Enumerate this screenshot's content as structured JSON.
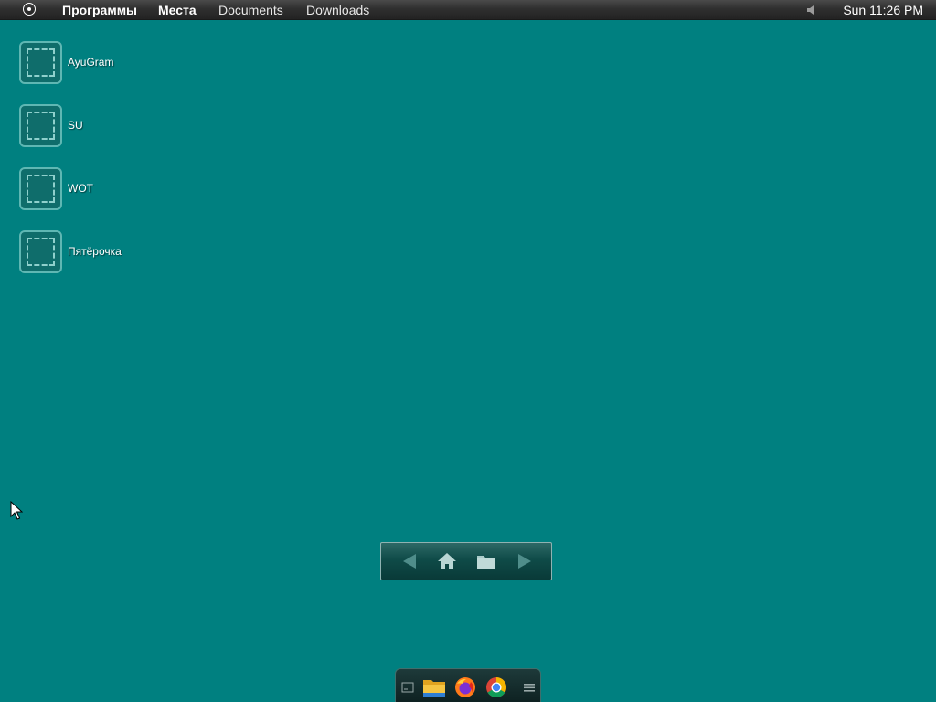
{
  "top_panel": {
    "menu_icon": "circle-dot-icon",
    "items": [
      {
        "label": "Программы",
        "style": "bold"
      },
      {
        "label": "Места",
        "style": "bold"
      },
      {
        "label": "Documents",
        "style": "plain"
      },
      {
        "label": "Downloads",
        "style": "plain"
      }
    ],
    "volume_icon": "speaker-icon",
    "clock": "Sun 11:26 PM"
  },
  "desktop": {
    "background_color": "#008080",
    "icons": [
      {
        "label": "AyuGram",
        "icon": "placeholder-app-icon"
      },
      {
        "label": "SU",
        "icon": "placeholder-app-icon"
      },
      {
        "label": "WOT",
        "icon": "placeholder-app-icon"
      },
      {
        "label": "Пятёрочка",
        "icon": "placeholder-app-icon"
      }
    ]
  },
  "nav_bar": {
    "buttons": [
      {
        "name": "back",
        "icon": "arrow-left-icon"
      },
      {
        "name": "home",
        "icon": "home-icon"
      },
      {
        "name": "folder",
        "icon": "folder-icon"
      },
      {
        "name": "forward",
        "icon": "arrow-right-icon"
      }
    ]
  },
  "dock": {
    "items": [
      {
        "name": "terminal",
        "icon": "terminal-icon"
      },
      {
        "name": "files",
        "icon": "folder-icon"
      },
      {
        "name": "firefox",
        "icon": "firefox-icon"
      },
      {
        "name": "chrome",
        "icon": "chrome-icon"
      },
      {
        "name": "menu",
        "icon": "hamburger-menu-icon"
      }
    ]
  }
}
